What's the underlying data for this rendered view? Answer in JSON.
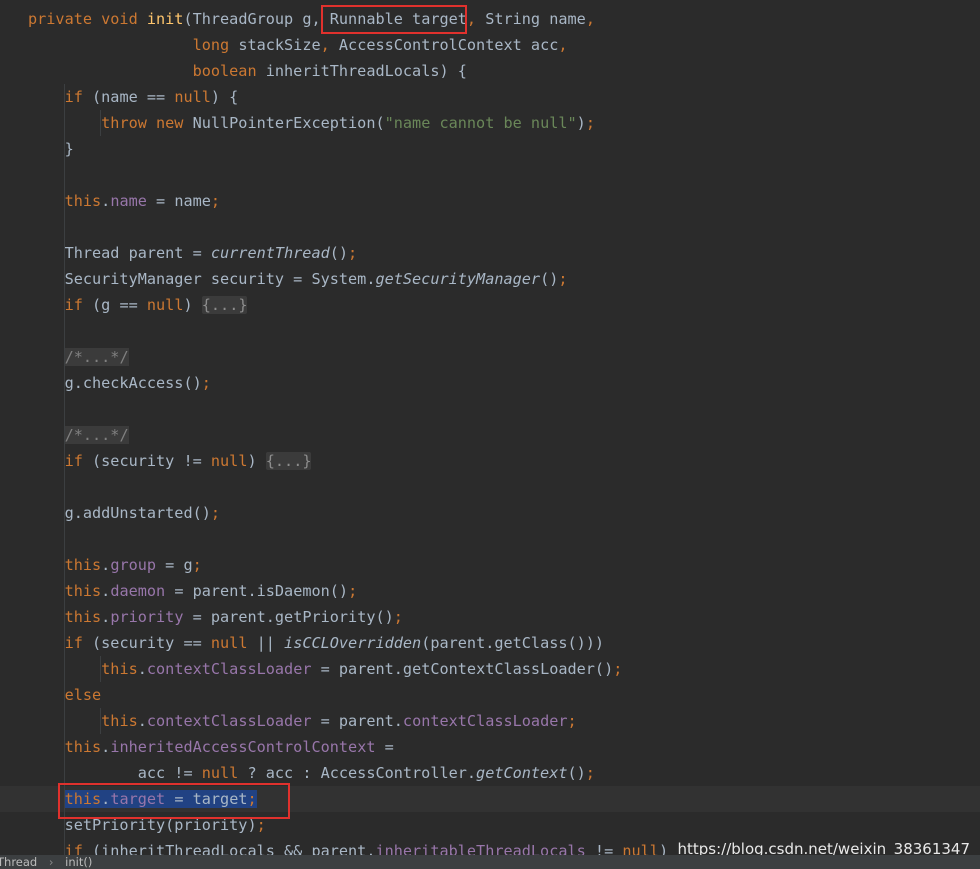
{
  "code_lines": [
    [
      [
        "kw",
        "private void "
      ],
      [
        "fn",
        "init"
      ],
      [
        "p",
        "(ThreadGroup g, "
      ],
      [
        "p",
        "Runnable target"
      ],
      [
        "kw",
        ", "
      ],
      [
        "p",
        "String name"
      ],
      [
        "kw",
        ","
      ]
    ],
    [
      [
        "p",
        "                  "
      ],
      [
        "kw",
        "long "
      ],
      [
        "p",
        "stackSize"
      ],
      [
        "kw",
        ", "
      ],
      [
        "p",
        "AccessControlContext acc"
      ],
      [
        "kw",
        ","
      ]
    ],
    [
      [
        "p",
        "                  "
      ],
      [
        "kw",
        "boolean "
      ],
      [
        "p",
        "inheritThreadLocals) {"
      ]
    ],
    [
      [
        "p",
        "    "
      ],
      [
        "kw",
        "if "
      ],
      [
        "p",
        "(name == "
      ],
      [
        "kw",
        "null"
      ],
      [
        "p",
        ") {"
      ]
    ],
    [
      [
        "p",
        "        "
      ],
      [
        "kw",
        "throw new "
      ],
      [
        "p",
        "NullPointerException("
      ],
      [
        "str",
        "\"name cannot be null\""
      ],
      [
        "p",
        ")"
      ],
      [
        "kw",
        ";"
      ]
    ],
    [
      [
        "p",
        "    }"
      ]
    ],
    [
      [
        "p",
        ""
      ]
    ],
    [
      [
        "p",
        "    "
      ],
      [
        "kw",
        "this"
      ],
      [
        "p",
        "."
      ],
      [
        "fld",
        "name"
      ],
      [
        "p",
        " = name"
      ],
      [
        "kw",
        ";"
      ]
    ],
    [
      [
        "p",
        ""
      ]
    ],
    [
      [
        "p",
        "    Thread parent = "
      ],
      [
        "it",
        "currentThread"
      ],
      [
        "p",
        "()"
      ],
      [
        "kw",
        ";"
      ]
    ],
    [
      [
        "p",
        "    SecurityManager security = System."
      ],
      [
        "it",
        "getSecurityManager"
      ],
      [
        "p",
        "()"
      ],
      [
        "kw",
        ";"
      ]
    ],
    [
      [
        "p",
        "    "
      ],
      [
        "kw",
        "if "
      ],
      [
        "p",
        "(g == "
      ],
      [
        "kw",
        "null"
      ],
      [
        "p",
        ") "
      ],
      [
        "fold",
        "{...}"
      ]
    ],
    [
      [
        "p",
        ""
      ]
    ],
    [
      [
        "p",
        "    "
      ],
      [
        "cmt",
        "/*...*/"
      ]
    ],
    [
      [
        "p",
        "    g.checkAccess()"
      ],
      [
        "kw",
        ";"
      ]
    ],
    [
      [
        "p",
        ""
      ]
    ],
    [
      [
        "p",
        "    "
      ],
      [
        "cmt",
        "/*...*/"
      ]
    ],
    [
      [
        "p",
        "    "
      ],
      [
        "kw",
        "if "
      ],
      [
        "p",
        "(security != "
      ],
      [
        "kw",
        "null"
      ],
      [
        "p",
        ") "
      ],
      [
        "fold",
        "{...}"
      ]
    ],
    [
      [
        "p",
        ""
      ]
    ],
    [
      [
        "p",
        "    g.addUnstarted()"
      ],
      [
        "kw",
        ";"
      ]
    ],
    [
      [
        "p",
        ""
      ]
    ],
    [
      [
        "p",
        "    "
      ],
      [
        "kw",
        "this"
      ],
      [
        "p",
        "."
      ],
      [
        "fld",
        "group"
      ],
      [
        "p",
        " = g"
      ],
      [
        "kw",
        ";"
      ]
    ],
    [
      [
        "p",
        "    "
      ],
      [
        "kw",
        "this"
      ],
      [
        "p",
        "."
      ],
      [
        "fld",
        "daemon"
      ],
      [
        "p",
        " = parent.isDaemon()"
      ],
      [
        "kw",
        ";"
      ]
    ],
    [
      [
        "p",
        "    "
      ],
      [
        "kw",
        "this"
      ],
      [
        "p",
        "."
      ],
      [
        "fld",
        "priority"
      ],
      [
        "p",
        " = parent.getPriority()"
      ],
      [
        "kw",
        ";"
      ]
    ],
    [
      [
        "p",
        "    "
      ],
      [
        "kw",
        "if "
      ],
      [
        "p",
        "(security == "
      ],
      [
        "kw",
        "null "
      ],
      [
        "p",
        "|| "
      ],
      [
        "it",
        "isCCLOverridden"
      ],
      [
        "p",
        "(parent.getClass()))"
      ]
    ],
    [
      [
        "p",
        "        "
      ],
      [
        "kw",
        "this"
      ],
      [
        "p",
        "."
      ],
      [
        "fld",
        "contextClassLoader"
      ],
      [
        "p",
        " = parent.getContextClassLoader()"
      ],
      [
        "kw",
        ";"
      ]
    ],
    [
      [
        "p",
        "    "
      ],
      [
        "kw",
        "else"
      ]
    ],
    [
      [
        "p",
        "        "
      ],
      [
        "kw",
        "this"
      ],
      [
        "p",
        "."
      ],
      [
        "fld",
        "contextClassLoader"
      ],
      [
        "p",
        " = parent."
      ],
      [
        "fld",
        "contextClassLoader"
      ],
      [
        "kw",
        ";"
      ]
    ],
    [
      [
        "p",
        "    "
      ],
      [
        "kw",
        "this"
      ],
      [
        "p",
        "."
      ],
      [
        "fld",
        "inheritedAccessControlContext"
      ],
      [
        "p",
        " ="
      ]
    ],
    [
      [
        "p",
        "            acc != "
      ],
      [
        "kw",
        "null "
      ],
      [
        "p",
        "? acc : AccessController."
      ],
      [
        "it",
        "getContext"
      ],
      [
        "p",
        "()"
      ],
      [
        "kw",
        ";"
      ]
    ],
    [
      [
        "p",
        "    "
      ],
      [
        "kw",
        "this"
      ],
      [
        "p",
        "."
      ],
      [
        "fld",
        "target"
      ],
      [
        "p",
        " = target"
      ],
      [
        "kw",
        ";"
      ]
    ],
    [
      [
        "p",
        "    setPriority(priority)"
      ],
      [
        "kw",
        ";"
      ]
    ],
    [
      [
        "p",
        "    "
      ],
      [
        "kw",
        "if "
      ],
      [
        "p",
        "(inheritThreadLocals && parent."
      ],
      [
        "fld",
        "inheritableThreadLocals"
      ],
      [
        "p",
        " != "
      ],
      [
        "kw",
        "null"
      ],
      [
        "p",
        ")"
      ]
    ]
  ],
  "watermark": "https://blog.csdn.net/weixin_38361347",
  "breadcrumb": [
    "Thread",
    "init()"
  ],
  "colors": {
    "background": "#2b2b2b",
    "keyword": "#cc7832",
    "method_decl": "#ffc66d",
    "field": "#9876aa",
    "string": "#6a8759",
    "text": "#a9b7c6",
    "selection": "#214283",
    "annotation_box": "#e0312d"
  }
}
